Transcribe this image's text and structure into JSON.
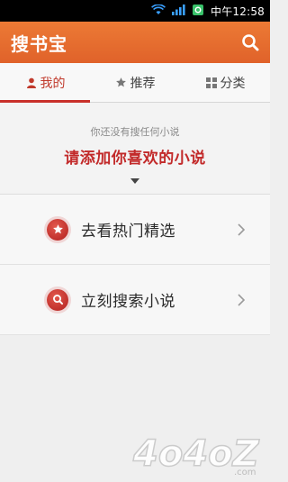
{
  "status_bar": {
    "time": "中午12:58"
  },
  "app_bar": {
    "title": "搜书宝"
  },
  "tabs": [
    {
      "label": "我的",
      "icon": "person-icon",
      "active": true
    },
    {
      "label": "推荐",
      "icon": "star-icon",
      "active": false
    },
    {
      "label": "分类",
      "icon": "grid-icon",
      "active": false
    }
  ],
  "empty_state": {
    "hint": "你还没有搜任何小说",
    "cta": "请添加你喜欢的小说"
  },
  "actions": [
    {
      "label": "去看热门精选",
      "icon": "star-badge-icon"
    },
    {
      "label": "立刻搜索小说",
      "icon": "search-badge-icon"
    }
  ],
  "watermark": {
    "text": "4o4oZ",
    "subtext": ".com"
  },
  "colors": {
    "accent": "#e0622a",
    "brand_red": "#c22a2a"
  }
}
